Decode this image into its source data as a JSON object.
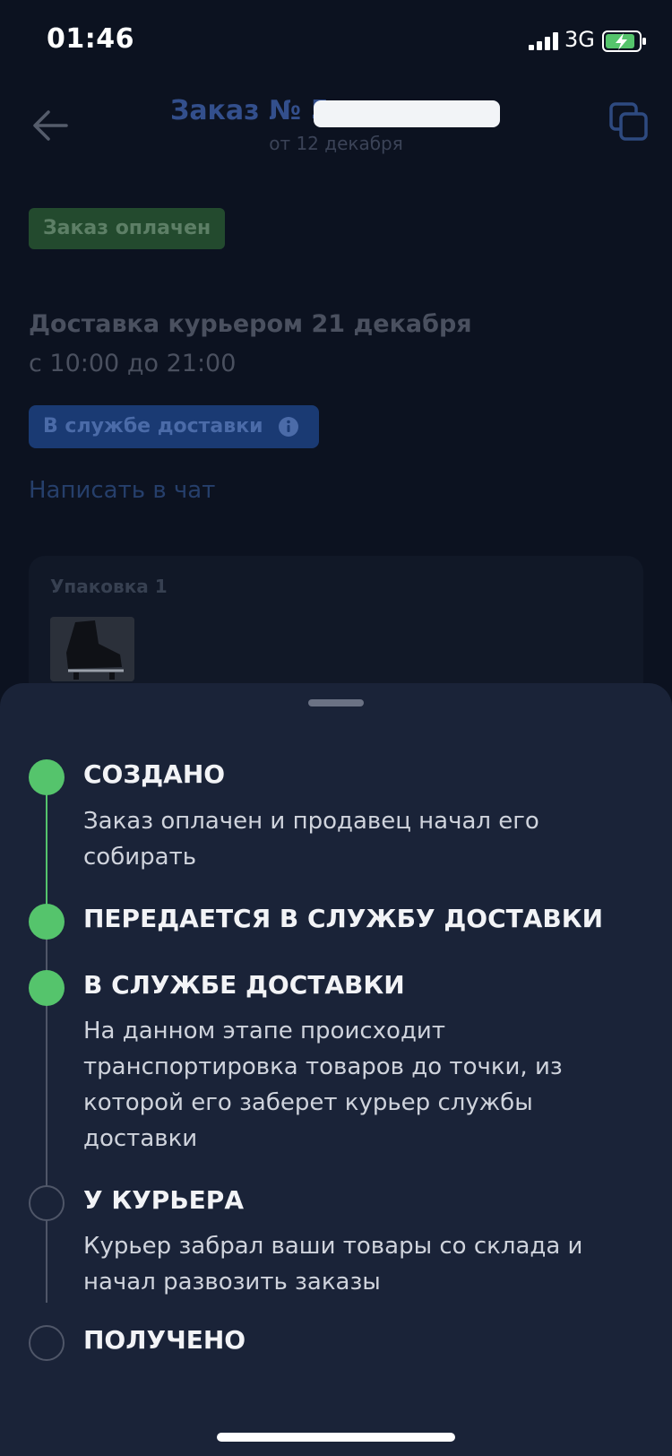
{
  "status_bar": {
    "time": "01:46",
    "network": "3G"
  },
  "header": {
    "title_prefix": "Заказ № 5",
    "order_date": "от 12 декабря"
  },
  "order": {
    "payment_status": "Заказ оплачен",
    "delivery_title": "Доставка курьером 21 декабря",
    "delivery_window": "с 10:00 до 21:00",
    "delivery_status": "В службе доставки",
    "chat_link": "Написать в чат",
    "package_title": "Упаковка 1"
  },
  "timeline": {
    "steps": [
      {
        "title": "СОЗДАНО",
        "description": "Заказ оплачен и продавец начал его собирать",
        "done": true
      },
      {
        "title": "ПЕРЕДАЕТСЯ В СЛУЖБУ ДОСТАВКИ",
        "description": "",
        "done": true
      },
      {
        "title": "В СЛУЖБЕ ДОСТАВКИ",
        "description": "На данном этапе происходит транспортировка товаров до точки, из которой его заберет курьер службы доставки",
        "done": true
      },
      {
        "title": "У КУРЬЕРА",
        "description": "Курьер забрал ваши товары со склада и начал развозить заказы",
        "done": false
      },
      {
        "title": "ПОЛУЧЕНО",
        "description": "",
        "done": false
      }
    ]
  },
  "colors": {
    "done": "#55c46c",
    "pending": "#4f5668",
    "sheet": "#1a2338",
    "background": "#0c1220"
  },
  "icons": [
    "back-arrow-icon",
    "copy-icon",
    "info-icon",
    "signal-icon",
    "battery-charging-icon",
    "skate-thumbnail"
  ]
}
